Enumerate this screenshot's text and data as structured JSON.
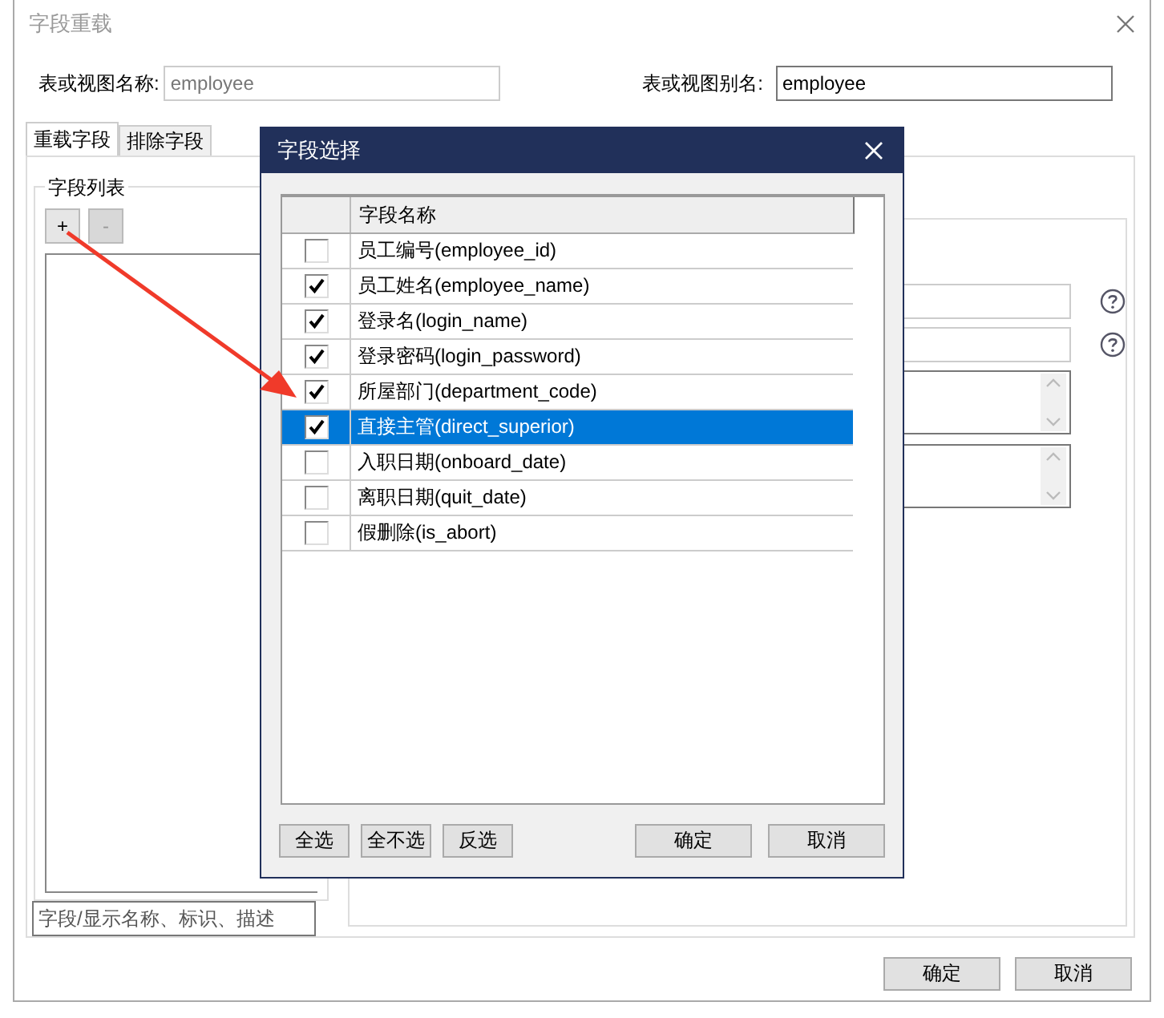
{
  "dialog": {
    "title": "字段重载",
    "table_name_label": "表或视图名称:",
    "table_name": "employee",
    "alias_label": "表或视图别名:",
    "alias": "employee",
    "tabs": [
      {
        "label": "重载字段",
        "selected": true
      },
      {
        "label": "排除字段",
        "selected": false
      }
    ],
    "field_list": {
      "title": "字段列表",
      "add_button": "+",
      "remove_button": "-",
      "remove_disabled": true,
      "search_placeholder": "字段/显示名称、标识、描述"
    },
    "buttons": [
      "确定",
      "取消"
    ]
  },
  "field_picker": {
    "title": "字段选择",
    "column": "字段名称",
    "rows": [
      {
        "label": "员工编号(employee_id)",
        "checked": false,
        "selected": false
      },
      {
        "label": "员工姓名(employee_name)",
        "checked": true,
        "selected": false
      },
      {
        "label": "登录名(login_name)",
        "checked": true,
        "selected": false
      },
      {
        "label": "登录密码(login_password)",
        "checked": true,
        "selected": false
      },
      {
        "label": "所屋部门(department_code)",
        "checked": true,
        "selected": false
      },
      {
        "label": "直接主管(direct_superior)",
        "checked": true,
        "selected": true
      },
      {
        "label": "入职日期(onboard_date)",
        "checked": false,
        "selected": false
      },
      {
        "label": "离职日期(quit_date)",
        "checked": false,
        "selected": false
      },
      {
        "label": "假删除(is_abort)",
        "checked": false,
        "selected": false
      }
    ],
    "buttons_left": [
      "全选",
      "全不选",
      "反选"
    ],
    "buttons_right": [
      "确定",
      "取消"
    ]
  }
}
